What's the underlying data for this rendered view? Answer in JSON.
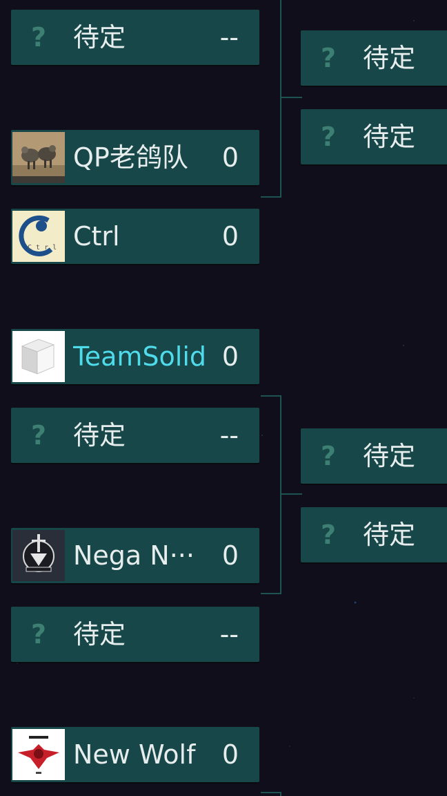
{
  "colors": {
    "background": "#0f0e1a",
    "slot": "#174748",
    "connector": "#1d5453",
    "highlight_text": "#4fdbea",
    "placeholder_icon": "#3d7f72"
  },
  "round1": [
    {
      "name": "待定",
      "score": "--",
      "logo": "question-icon"
    },
    {
      "name": "QP老鸽队",
      "score": "0",
      "logo": "team-logo-qp"
    },
    {
      "name": "Ctrl",
      "score": "0",
      "logo": "team-logo-ctrl"
    },
    {
      "name": "TeamSolid",
      "score": "0",
      "logo": "team-logo-cube",
      "highlighted": true
    },
    {
      "name": "待定",
      "score": "--",
      "logo": "question-icon"
    },
    {
      "name": "Nega N···",
      "score": "0",
      "logo": "team-logo-nega"
    },
    {
      "name": "待定",
      "score": "--",
      "logo": "question-icon"
    },
    {
      "name": "New Wolf",
      "score": "0",
      "logo": "team-logo-wolf"
    }
  ],
  "round2": [
    {
      "name": "待定",
      "logo": "question-icon"
    },
    {
      "name": "待定",
      "logo": "question-icon"
    },
    {
      "name": "待定",
      "logo": "question-icon"
    },
    {
      "name": "待定",
      "logo": "question-icon"
    }
  ],
  "placeholder_glyph": "?"
}
